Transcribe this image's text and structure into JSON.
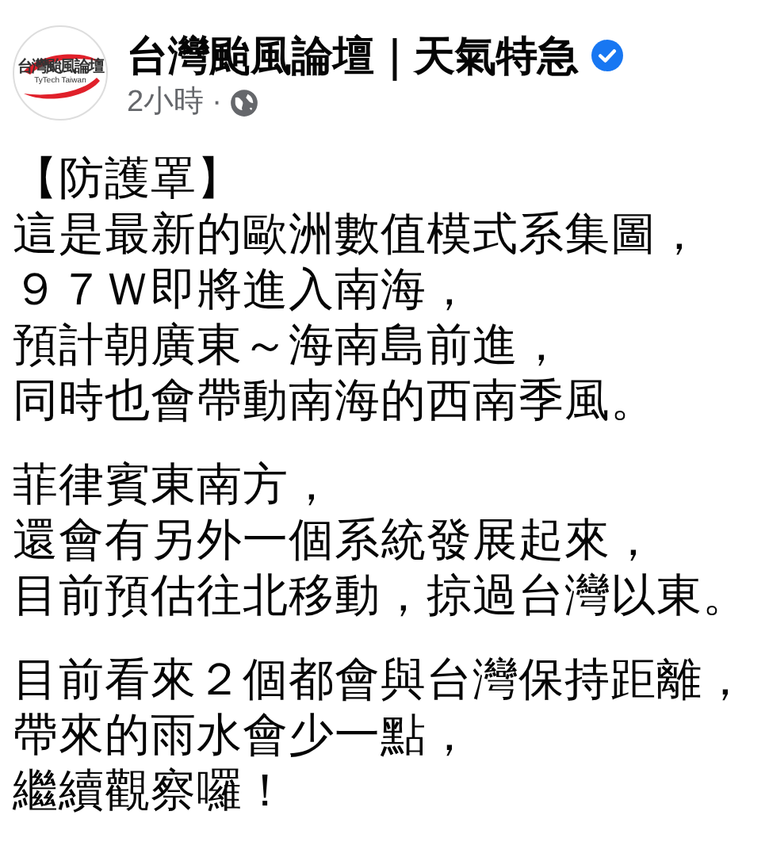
{
  "post": {
    "author": "台灣颱風論壇｜天氣特急",
    "verified": true,
    "avatar": {
      "logo_text": "台灣颱風論壇",
      "logo_subtext": "TyTech Taiwan"
    },
    "time": "2小時",
    "separator": "·",
    "paragraphs": [
      [
        "【防護罩】",
        "這是最新的歐洲數值模式系集圖，",
        "９７Ｗ即將進入南海，",
        "預計朝廣東～海南島前進，",
        "同時也會帶動南海的西南季風。"
      ],
      [
        "菲律賓東南方，",
        "還會有另外一個系統發展起來，",
        "目前預估往北移動，掠過台灣以東。"
      ],
      [
        "目前看來２個都會與台灣保持距離，",
        "帶來的雨水會少一點，",
        "繼續觀察囉！"
      ]
    ]
  }
}
